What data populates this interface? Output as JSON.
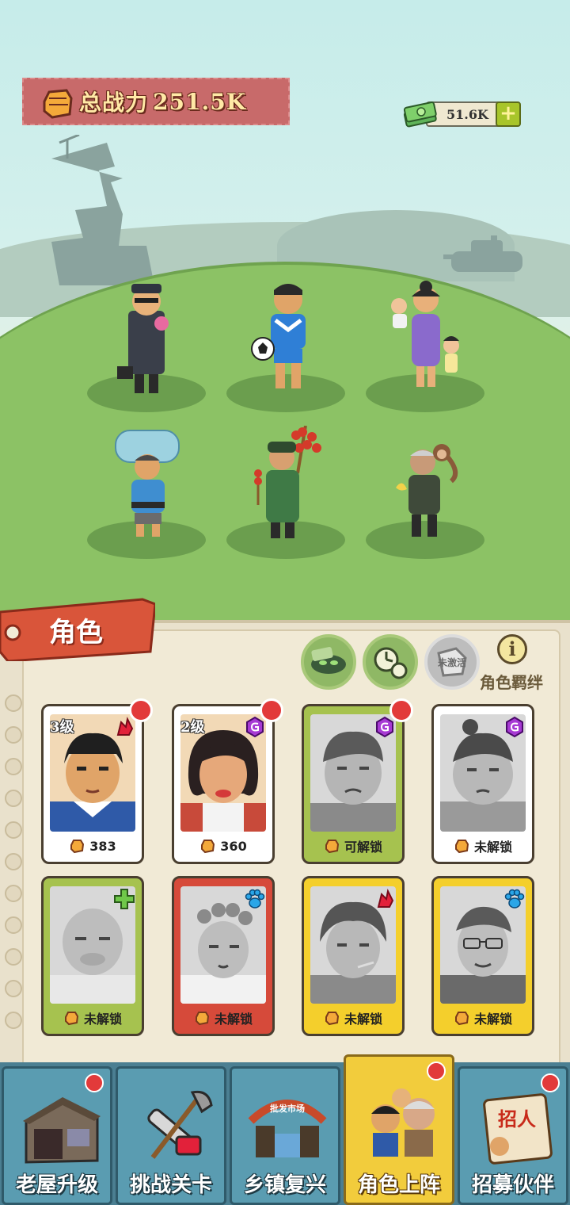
{
  "hud": {
    "power_label": "总战力",
    "power_value": "251.5K",
    "cash_value": "51.6K",
    "cash_add": "+"
  },
  "panel": {
    "tag_label": "角色",
    "bond_label": "角色羁绊",
    "info_glyph": "i",
    "buttons": [
      {
        "icon": "mask-icon"
      },
      {
        "icon": "timer-icon"
      },
      {
        "icon": "skill-locked-icon",
        "text": "未激活"
      }
    ]
  },
  "cards": [
    {
      "level": "3级",
      "footer": "383",
      "badge": "fire-icon",
      "frame": "white",
      "unlocked": true,
      "dot": true
    },
    {
      "level": "2级",
      "footer": "360",
      "badge": "swirl-icon",
      "frame": "white",
      "unlocked": true,
      "dot": true
    },
    {
      "level": "",
      "footer": "可解锁",
      "badge": "swirl-icon",
      "frame": "olive",
      "unlocked": false,
      "dot": true
    },
    {
      "level": "",
      "footer": "未解锁",
      "badge": "swirl-icon",
      "frame": "white",
      "unlocked": false,
      "dot": false
    },
    {
      "level": "",
      "footer": "未解锁",
      "badge": "cross-icon",
      "frame": "green",
      "unlocked": false,
      "dot": false
    },
    {
      "level": "",
      "footer": "未解锁",
      "badge": "paw-icon",
      "frame": "red",
      "unlocked": false,
      "dot": false
    },
    {
      "level": "",
      "footer": "未解锁",
      "badge": "fire-icon",
      "frame": "gold",
      "unlocked": false,
      "dot": false
    },
    {
      "level": "",
      "footer": "未解锁",
      "badge": "paw-icon",
      "frame": "gold",
      "unlocked": false,
      "dot": false
    }
  ],
  "tabs": [
    {
      "label": "老屋升级",
      "icon": "house-icon",
      "dot": true,
      "active": false
    },
    {
      "label": "挑战关卡",
      "icon": "chainsaw-shovel-icon",
      "dot": false,
      "active": false
    },
    {
      "label": "乡镇复兴",
      "icon": "market-stall-icon",
      "dot": false,
      "active": false,
      "sign": "批发市场"
    },
    {
      "label": "角色上阵",
      "icon": "characters-icon",
      "dot": true,
      "active": true
    },
    {
      "label": "招募伙伴",
      "icon": "recruit-scroll-icon",
      "dot": true,
      "active": false,
      "sign": "招人"
    }
  ],
  "colors": {
    "accent_red": "#e23a3a",
    "banner": "#c86a6a",
    "grass": "#8cc265",
    "tab_blue": "#5a9cb1",
    "tab_active": "#f2cc3c"
  }
}
